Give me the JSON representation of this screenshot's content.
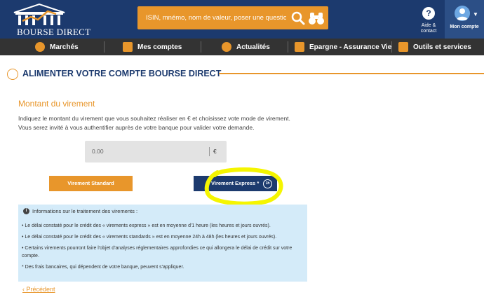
{
  "header": {
    "logo_text": "BOURSE DIRECT",
    "search_placeholder": "ISIN, mnémo, nom de valeur, poser une question",
    "help_label_1": "Aide &",
    "help_label_2": "contact",
    "account_label": "Mon compte"
  },
  "nav": {
    "items": [
      {
        "label": "Marchés",
        "icon": "bank-icon"
      },
      {
        "label": "Mes comptes",
        "icon": "wallet-icon"
      },
      {
        "label": "Actualités",
        "icon": "rss-icon"
      },
      {
        "label": "Epargne - Assurance Vie",
        "icon": "briefcase-icon"
      },
      {
        "label": "Outils et services",
        "icon": "calculator-icon"
      }
    ]
  },
  "page": {
    "title": "ALIMENTER VOTRE COMPTE BOURSE DIRECT",
    "section_title": "Montant du virement",
    "desc_1": "Indiquez le montant du virement que vous souhaitez réaliser en € et choisissez vote mode de virement.",
    "desc_2": "Vous serez invité à vous authentifier auprès de votre banque pour valider votre demande.",
    "amount_value": "0.00",
    "amount_unit": "€",
    "btn_standard": "Virement Standard",
    "btn_express": "Virement Express *",
    "express_badge": "1h",
    "info_title": "Informations sur le traitement des virements :",
    "info_bullets": [
      "Le délai constaté pour le crédit des « virements express » est en moyenne d'1 heure (les heures et jours ouvrés).",
      "Le délai constaté pour le crédit des « virements standards » est en moyenne 24h à 48h (les heures et jours ouvrés).",
      "Certains virements pourront faire l'objet d'analyses réglementaires approfondies ce qui allongera le délai de crédit sur votre compte.",
      "* Des frais bancaires, qui dépendent de votre banque, peuvent s'appliquer."
    ],
    "prev_link": "Précédent"
  },
  "colors": {
    "brand_blue": "#1c3a6e",
    "accent_orange": "#e8962b",
    "nav_dark": "#333333",
    "info_bg": "#d4ebf9",
    "highlight": "#f5f500"
  }
}
